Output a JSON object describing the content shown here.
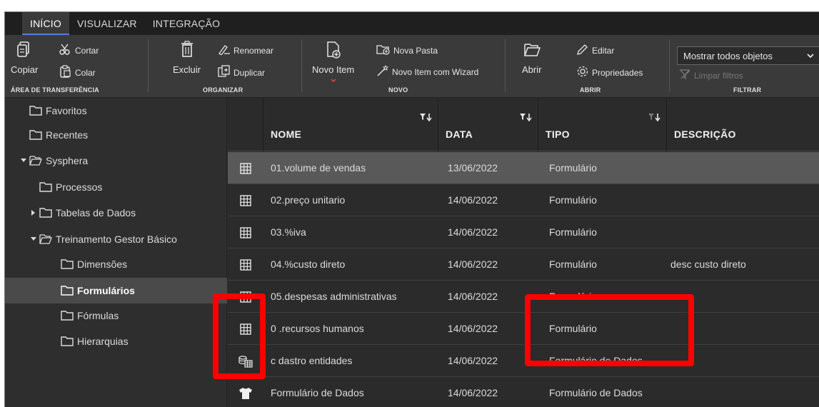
{
  "tabs": [
    {
      "label": "INÍCIO",
      "active": true
    },
    {
      "label": "VISUALIZAR",
      "active": false
    },
    {
      "label": "INTEGRAÇÃO",
      "active": false
    }
  ],
  "ribbon": {
    "copy": "Copiar",
    "cut": "Cortar",
    "paste": "Colar",
    "clipboard_group": "ÁREA DE TRANSFERÊNCIA",
    "delete": "Excluir",
    "rename": "Renomear",
    "duplicate": "Duplicar",
    "organize_group": "ORGANIZAR",
    "new_item": "Novo Item",
    "new_folder": "Nova Pasta",
    "new_item_wizard": "Novo Item com Wizard",
    "new_group": "NOVO",
    "open": "Abrir",
    "edit": "Editar",
    "properties": "Propriedades",
    "open_group": "ABRIR",
    "show_all": "Mostrar todos objetos",
    "clear_filters": "Limpar filtros",
    "filter_group": "FILTRAR"
  },
  "sidebar": {
    "items": [
      {
        "label": "Favoritos"
      },
      {
        "label": "Recentes"
      },
      {
        "label": "Sysphera",
        "expanded": true
      },
      {
        "label": "Processos"
      },
      {
        "label": "Tabelas de Dados",
        "expandable": true
      },
      {
        "label": "Treinamento Gestor Básico",
        "expanded": true
      },
      {
        "label": "Dimensões"
      },
      {
        "label": "Formulários",
        "selected": true
      },
      {
        "label": "Fórmulas"
      },
      {
        "label": "Hierarquias"
      }
    ]
  },
  "grid": {
    "columns": [
      "NOME",
      "DATA",
      "TIPO",
      "DESCRIÇÃO"
    ],
    "rows": [
      {
        "icon": "grid-icon",
        "name": "01.volume de vendas",
        "date": "13/06/2022",
        "type": "Formulário",
        "desc": "",
        "selected": true
      },
      {
        "icon": "grid-icon",
        "name": "02.preço unitario",
        "date": "14/06/2022",
        "type": "Formulário",
        "desc": ""
      },
      {
        "icon": "grid-icon",
        "name": "03.%iva",
        "date": "14/06/2022",
        "type": "Formulário",
        "desc": ""
      },
      {
        "icon": "grid-icon",
        "name": "04.%custo direto",
        "date": "14/06/2022",
        "type": "Formulário",
        "desc": "desc custo direto"
      },
      {
        "icon": "grid-icon",
        "name": "05.despesas administrativas",
        "date": "14/06/2022",
        "type": "Formulário",
        "desc": ""
      },
      {
        "icon": "grid-icon",
        "name": "0 .recursos humanos",
        "date": "14/06/2022",
        "type": "Formulário",
        "desc": ""
      },
      {
        "icon": "data-form-icon",
        "name": "c dastro entidades",
        "date": "14/06/2022",
        "type": "Formulário de Dados",
        "desc": ""
      },
      {
        "icon": "shirt-icon",
        "name": "Formulário de Dados",
        "date": "14/06/2022",
        "type": "Formulário de Dados",
        "desc": ""
      }
    ]
  },
  "colors": {
    "annotation": "#ff0000",
    "selected_row": "#595959",
    "ribbon": "#3a3a3a"
  }
}
